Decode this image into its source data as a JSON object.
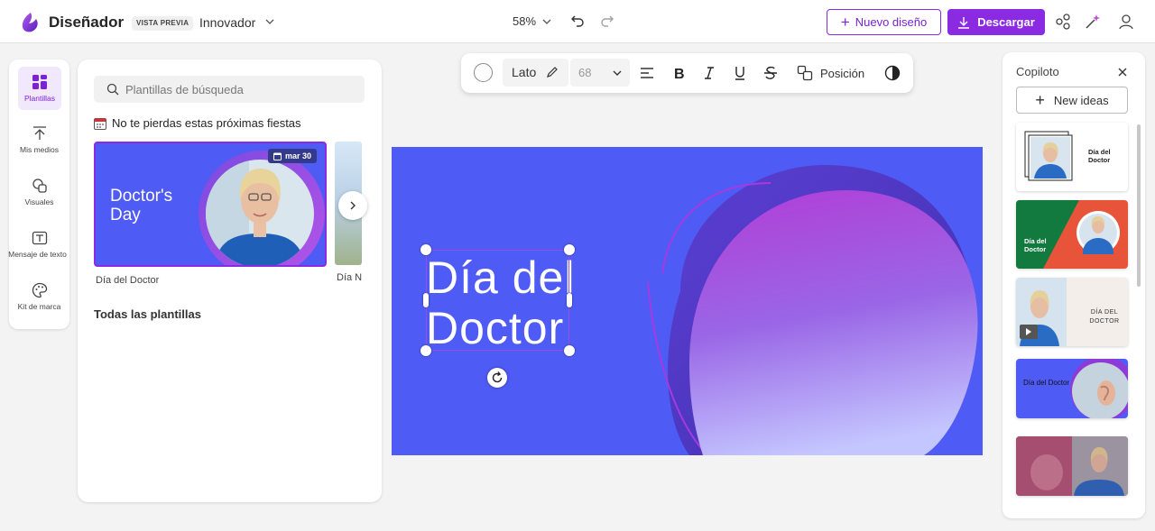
{
  "header": {
    "app_title": "Diseñador",
    "preview_badge": "VISTA PREVIA",
    "project_name": "Innovador",
    "zoom": "58%",
    "new_design": "Nuevo diseño",
    "download": "Descargar",
    "icons": [
      "undo-icon",
      "redo-icon",
      "share-icon",
      "magic-icon",
      "account-icon"
    ]
  },
  "rail": {
    "items": [
      {
        "label": "Plantillas",
        "icon": "templates-icon",
        "active": true
      },
      {
        "label": "Mis medios",
        "icon": "upload-icon"
      },
      {
        "label": "Visuales",
        "icon": "visuals-icon"
      },
      {
        "label": "Mensaje de texto",
        "icon": "text-icon"
      },
      {
        "label": "Kit de marca",
        "icon": "palette-icon"
      }
    ]
  },
  "templates": {
    "search_placeholder": "Plantillas de búsqueda",
    "section_title": "No te pierdas estas próximas fiestas",
    "card": {
      "title": "Doctor's Day",
      "date": "mar 30",
      "caption": "Día del Doctor"
    },
    "card2_caption": "Día N",
    "all_templates": "Todas las plantillas"
  },
  "format_bar": {
    "font": "Lato",
    "size": "68",
    "position": "Posición"
  },
  "canvas": {
    "text": "Día del Doctor",
    "background": "#4f5bf5"
  },
  "copilot": {
    "title": "Copiloto",
    "new_ideas": "New ideas",
    "cards": [
      {
        "text": "Día del Doctor"
      },
      {
        "text": "Día del Doctor"
      },
      {
        "text": "DÍA DEL DOCTOR"
      },
      {
        "text": "Día del Doctor"
      },
      {
        "text": ""
      }
    ]
  },
  "colors": {
    "accent": "#8a2be2",
    "canvas_blue": "#4f5bf5"
  }
}
